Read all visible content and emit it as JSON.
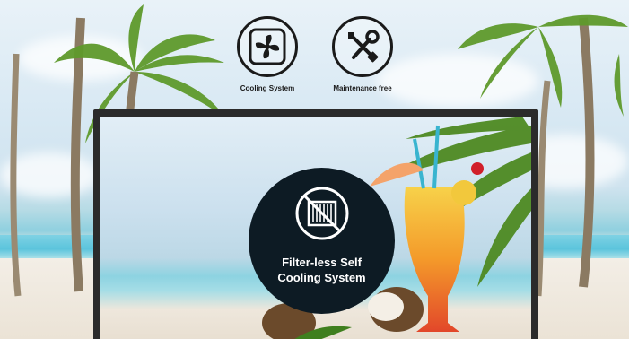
{
  "features": [
    {
      "label": "Cooling System",
      "icon": "fan-icon"
    },
    {
      "label": "Maintenance free",
      "icon": "wrench-screwdriver-icon"
    }
  ],
  "badge": {
    "line1": "Filter-less Self",
    "line2": "Cooling System",
    "icon": "no-filter-icon"
  },
  "colors": {
    "badge_bg": "#0d1b24",
    "monitor_frame": "#2b2b2b",
    "icon_stroke": "#1a1a1a"
  }
}
